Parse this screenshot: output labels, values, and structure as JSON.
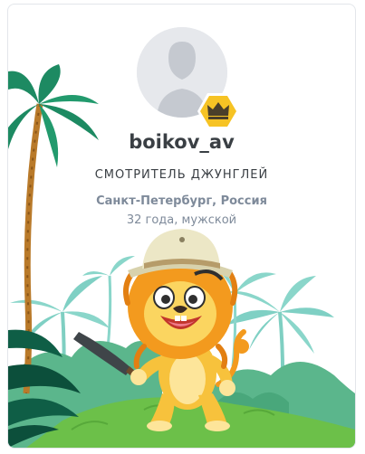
{
  "profile": {
    "username": "boikov_av",
    "rank": "СМОТРИТЕЛЬ ДЖУНГЛЕЙ",
    "location": "Санкт-Петербург, Россия",
    "details": "32 года, мужской"
  },
  "icons": {
    "avatar": "default-user-silhouette",
    "badge": "crown-hexagon-badge"
  },
  "colors": {
    "badge_fill": "#f6c324",
    "crown": "#4a3f2a",
    "grass": "#6cc049",
    "palm_dark": "#1f8a62",
    "palm_light": "#5fc6b1",
    "lion_mane": "#f39a1e",
    "lion_face": "#fbd560",
    "hat": "#ece7c6"
  }
}
